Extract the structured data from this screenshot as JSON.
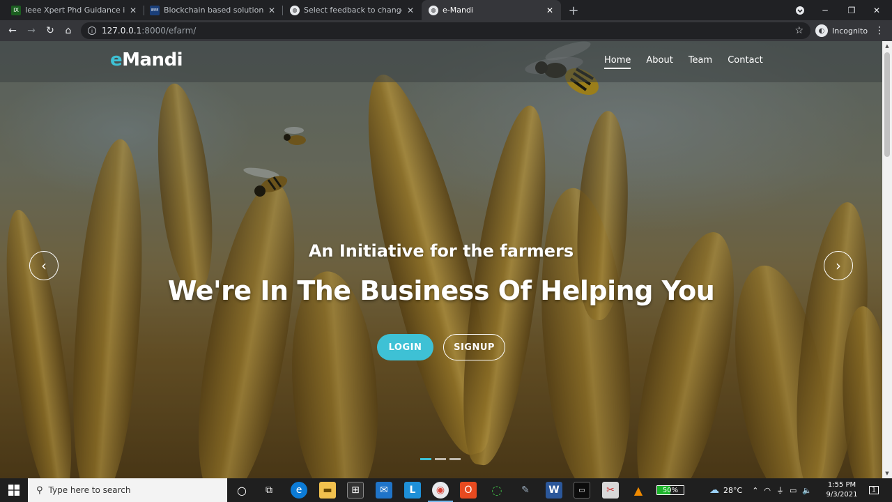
{
  "browser": {
    "tabs": [
      {
        "title": "Ieee Xpert Phd Guidance in Chen",
        "favicon": "IX"
      },
      {
        "title": "Blockchain based solution to imp",
        "favicon": "IEEE"
      },
      {
        "title": "Select feedback to change | Djan",
        "favicon": "globe"
      },
      {
        "title": "e-Mandi",
        "favicon": "globe"
      }
    ],
    "url_host": "127.0.0.1",
    "url_path": ":8000/efarm/",
    "profile_label": "Incognito"
  },
  "site": {
    "logo_accent": "e",
    "logo_rest": "Mandi",
    "nav": [
      "Home",
      "About",
      "Team",
      "Contact"
    ],
    "hero_subtitle": "An Initiative for the farmers",
    "hero_title": "We're In The Business Of Helping You",
    "login_label": "LOGIN",
    "signup_label": "SIGNUP",
    "accent_color": "#3ec1d5",
    "carousel_slides": 3,
    "carousel_active": 1
  },
  "taskbar": {
    "search_placeholder": "Type here to search",
    "battery": "50%",
    "temperature": "28°C",
    "time": "1:55 PM",
    "date": "9/3/2021",
    "notification_count": "1"
  }
}
